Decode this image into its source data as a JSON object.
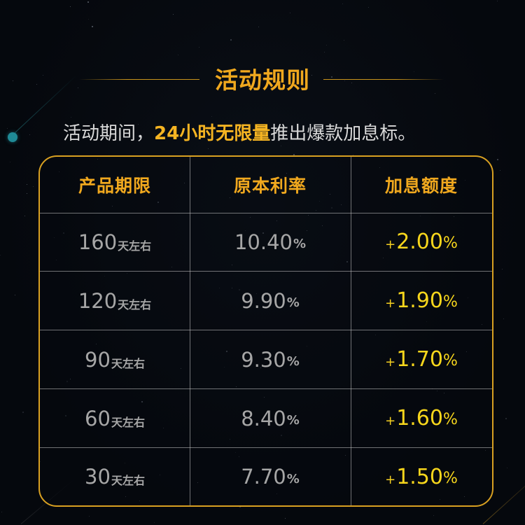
{
  "title": "活动规则",
  "subtitle": {
    "prefix": "活动期间，",
    "highlight": "24小时无限量",
    "suffix": "推出爆款加息标。"
  },
  "table": {
    "headers": [
      "产品期限",
      "原本利率",
      "加息额度"
    ],
    "unit_suffix": "天左右",
    "percent_sign": "%",
    "plus_sign": "+",
    "rows": [
      {
        "period": "160",
        "base_rate": "10.40",
        "bonus": "2.00"
      },
      {
        "period": "120",
        "base_rate": "9.90",
        "bonus": "1.90"
      },
      {
        "period": "90",
        "base_rate": "9.30",
        "bonus": "1.70"
      },
      {
        "period": "60",
        "base_rate": "8.40",
        "bonus": "1.60"
      },
      {
        "period": "30",
        "base_rate": "7.70",
        "bonus": "1.50"
      }
    ]
  },
  "colors": {
    "accent_gold": "#f0a81e",
    "bonus_yellow": "#f7d61c",
    "border_gold": "#d8a021",
    "muted_text": "#a6a6a6",
    "background": "#05080d",
    "teal_dot": "#1f8a96"
  }
}
